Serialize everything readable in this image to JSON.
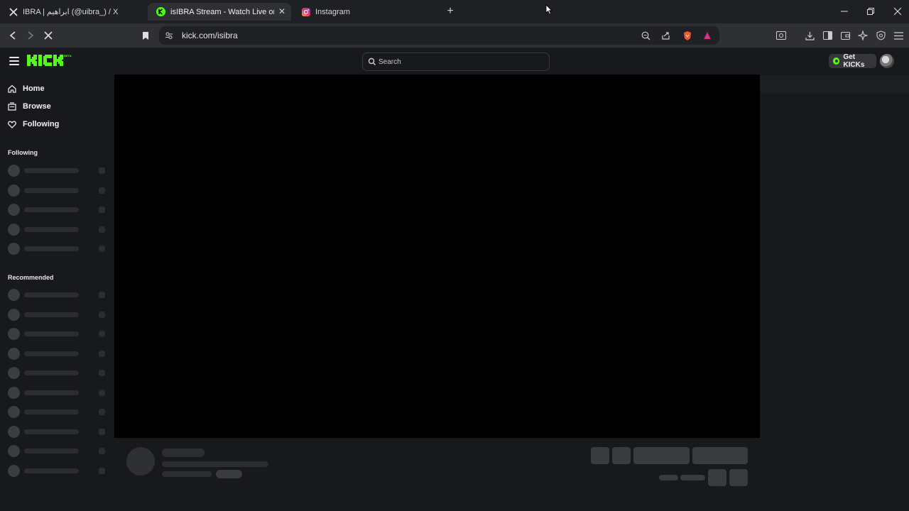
{
  "browser": {
    "tabs": [
      {
        "title": "IBRA | ابراهيم (@uibra_) / X",
        "icon": "x-logo-icon",
        "active": false
      },
      {
        "title": "isIBRA Stream - Watch Live on Kick",
        "icon": "kick-logo-icon",
        "active": true
      },
      {
        "title": "Instagram",
        "icon": "instagram-icon",
        "active": false
      }
    ],
    "url": "kick.com/isibra",
    "shield_badge_color": "#fb542b",
    "rewards_color": "#e0245e"
  },
  "kick": {
    "logo_text": "KICK",
    "logo_badge": "BETA",
    "brand_color": "#53fc18",
    "search_placeholder": "Search",
    "get_kicks_label": "Get KICKs",
    "nav": [
      {
        "label": "Home",
        "icon": "home-icon"
      },
      {
        "label": "Browse",
        "icon": "browse-icon"
      },
      {
        "label": "Following",
        "icon": "heart-icon"
      }
    ],
    "following_heading": "Following",
    "recommended_heading": "Recommended",
    "following_placeholders": 5,
    "recommended_placeholders": 10
  }
}
